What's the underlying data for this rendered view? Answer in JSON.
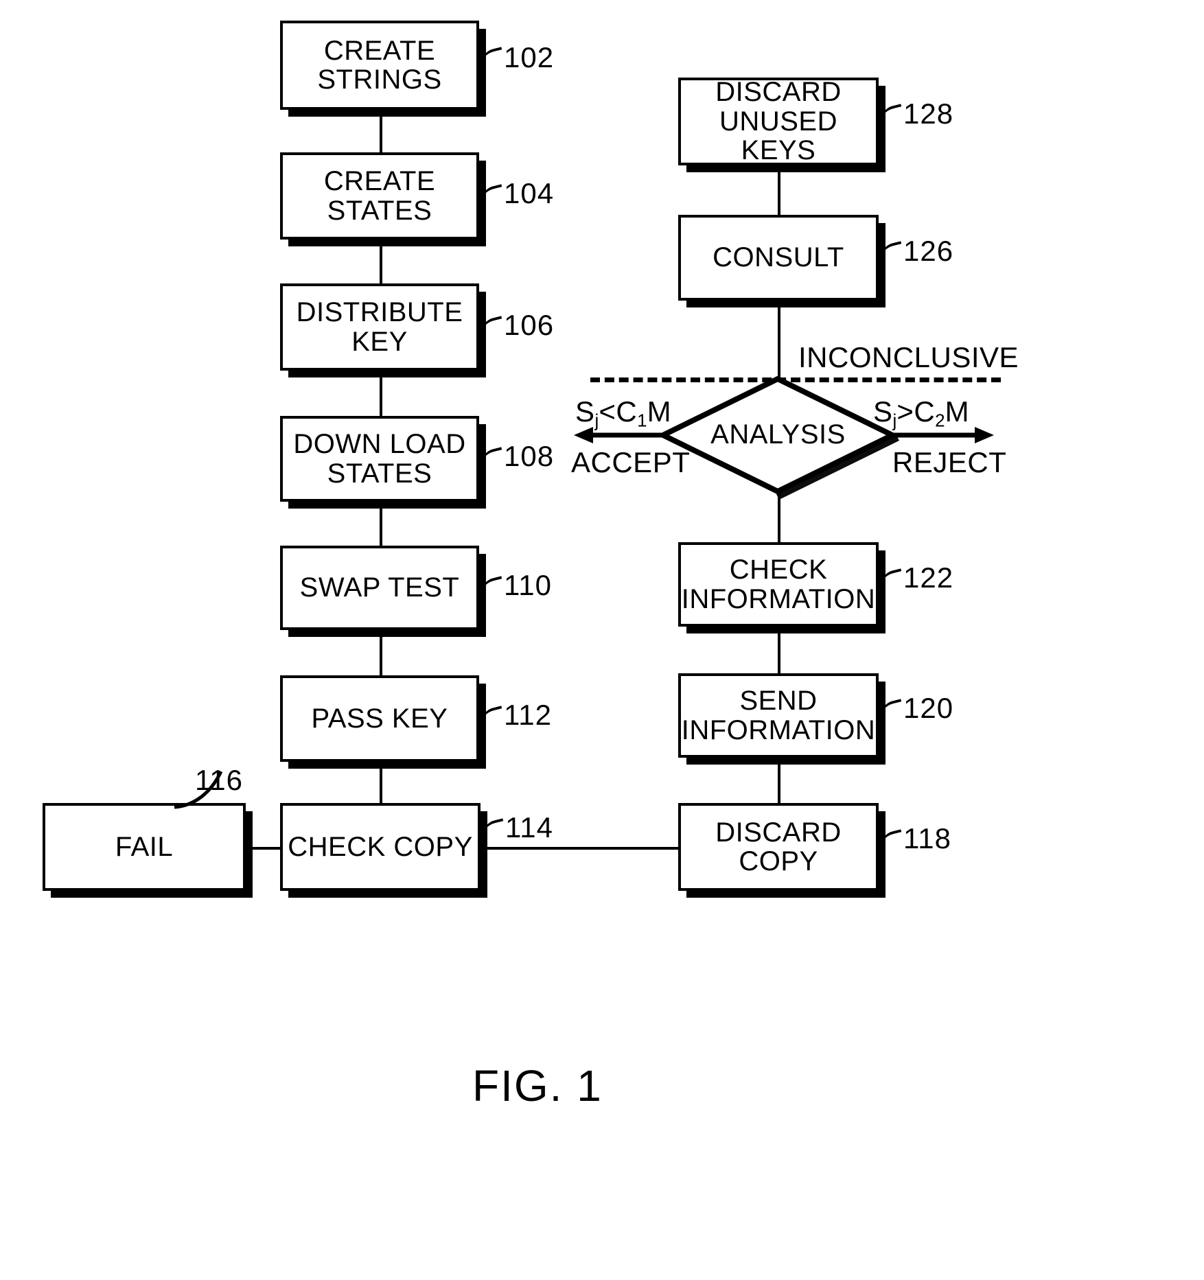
{
  "figure": {
    "caption": "FIG. 1"
  },
  "left_column": {
    "nodes": [
      {
        "id": "create-strings",
        "label": "CREATE\nSTRINGS",
        "ref": "102"
      },
      {
        "id": "create-states",
        "label": "CREATE\nSTATES",
        "ref": "104"
      },
      {
        "id": "distribute-key",
        "label": "DISTRIBUTE\nKEY",
        "ref": "106"
      },
      {
        "id": "down-load-states",
        "label": "DOWN LOAD\nSTATES",
        "ref": "108"
      },
      {
        "id": "swap-test",
        "label": "SWAP TEST",
        "ref": "110"
      },
      {
        "id": "pass-key",
        "label": "PASS KEY",
        "ref": "112"
      },
      {
        "id": "check-copy",
        "label": "CHECK COPY",
        "ref": "114"
      }
    ],
    "fail_node": {
      "id": "fail",
      "label": "FAIL",
      "ref": "116"
    }
  },
  "right_column": {
    "nodes": [
      {
        "id": "discard-unused-keys",
        "label": "DISCARD\nUNUSED KEYS",
        "ref": "128"
      },
      {
        "id": "consult",
        "label": "CONSULT",
        "ref": "126"
      },
      {
        "id": "check-information",
        "label": "CHECK\nINFORMATION",
        "ref": "122"
      },
      {
        "id": "send-information",
        "label": "SEND\nINFORMATION",
        "ref": "120"
      },
      {
        "id": "discard-copy",
        "label": "DISCARD\nCOPY",
        "ref": "118"
      }
    ]
  },
  "decision": {
    "label": "ANALYSIS",
    "inconclusive_label": "INCONCLUSIVE",
    "left_branch": {
      "condition_prefix": "S",
      "condition_sub1": "j",
      "condition_operator": "<C",
      "condition_sub2": "1",
      "condition_suffix": "M",
      "outcome": "ACCEPT"
    },
    "right_branch": {
      "condition_prefix": "S",
      "condition_sub1": "j",
      "condition_operator": ">C",
      "condition_sub2": "2",
      "condition_suffix": "M",
      "outcome": "REJECT"
    }
  },
  "colors": {
    "ink": "#000000",
    "paper": "#ffffff"
  }
}
